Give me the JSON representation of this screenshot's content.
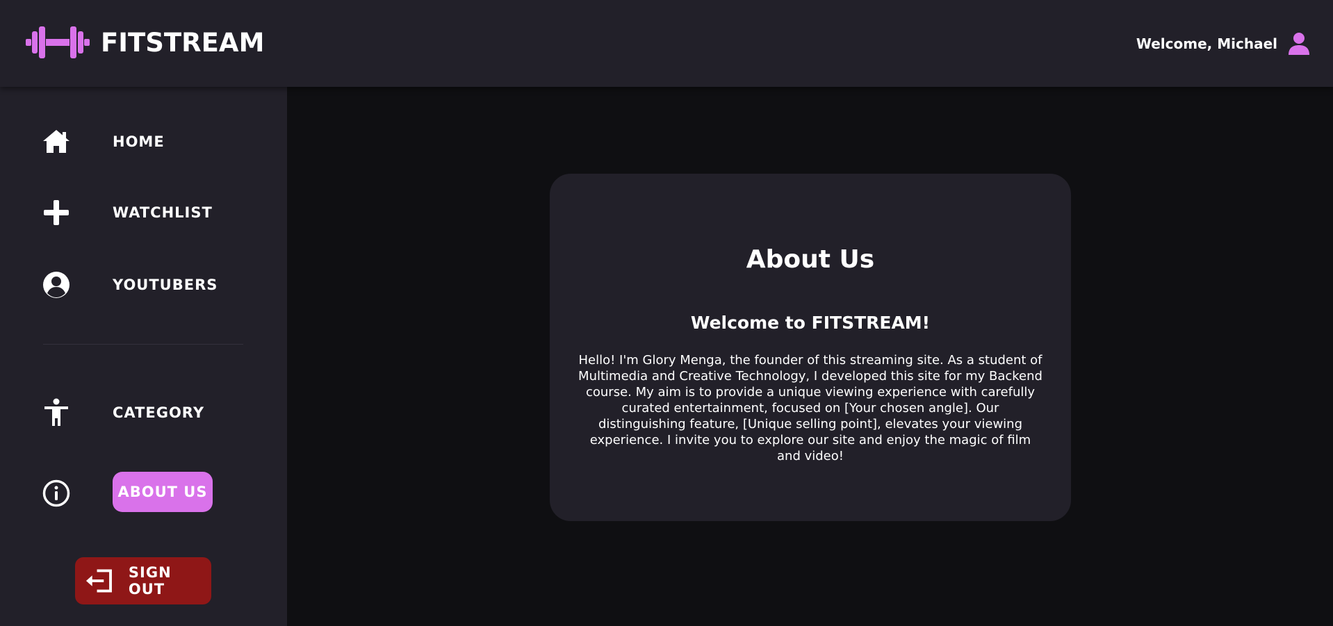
{
  "header": {
    "brand": "FITSTREAM",
    "welcome": "Welcome, Michael"
  },
  "sidebar": {
    "items": [
      {
        "label": "HOME",
        "icon": "home-icon"
      },
      {
        "label": "WATCHLIST",
        "icon": "plus-icon"
      },
      {
        "label": "YOUTUBERS",
        "icon": "user-circle-icon"
      },
      {
        "label": "CATEGORY",
        "icon": "person-icon"
      },
      {
        "label": "ABOUT US",
        "icon": "info-icon",
        "active": true
      }
    ],
    "signout_label": "SIGN OUT"
  },
  "main": {
    "title": "About Us",
    "subtitle": "Welcome to FITSTREAM!",
    "body": "Hello! I'm Glory Menga, the founder of this streaming site. As a student of Multimedia and Creative Technology, I developed this site for my Backend course. My aim is to provide a unique viewing experience with carefully curated entertainment, focused on [Your chosen angle]. Our distinguishing feature, [Unique selling point], elevates your viewing experience. I invite you to explore our site and enjoy the magic of film and video!"
  },
  "colors": {
    "accent": "#d972ea",
    "background": "#0f0f12",
    "panel": "#222029",
    "signout": "#8f1717"
  }
}
